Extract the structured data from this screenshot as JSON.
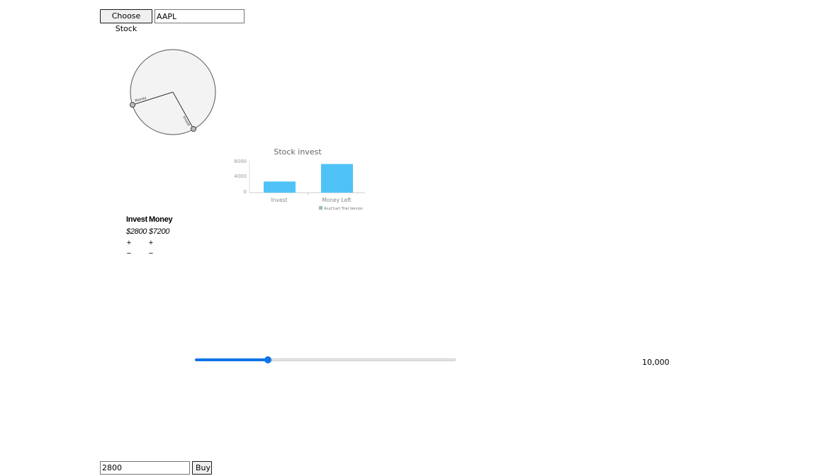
{
  "top_bar": {
    "choose_button_label": "Choose Stock",
    "stock_input_value": "AAPL"
  },
  "pie": {
    "label_a": "Money",
    "label_b": "Invest"
  },
  "chart_data": {
    "type": "bar",
    "title": "Stock invest",
    "categories": [
      "Invest",
      "Money Left"
    ],
    "values": [
      2800,
      7200
    ],
    "yticks": [
      "0",
      "4000",
      "8000"
    ],
    "ylim": [
      0,
      8000
    ],
    "color": "#4fc3f7",
    "watermark": "AnyChart Trial Version"
  },
  "table": {
    "headers": [
      "Invest",
      "Money"
    ],
    "values": [
      "$2800",
      "$7200"
    ],
    "plus": "+",
    "minus": "−"
  },
  "slider": {
    "value_fraction": 0.28,
    "max_label": "10,000"
  },
  "bottom_bar": {
    "amount_input_value": "2800",
    "buy_button_label": "Buy"
  }
}
